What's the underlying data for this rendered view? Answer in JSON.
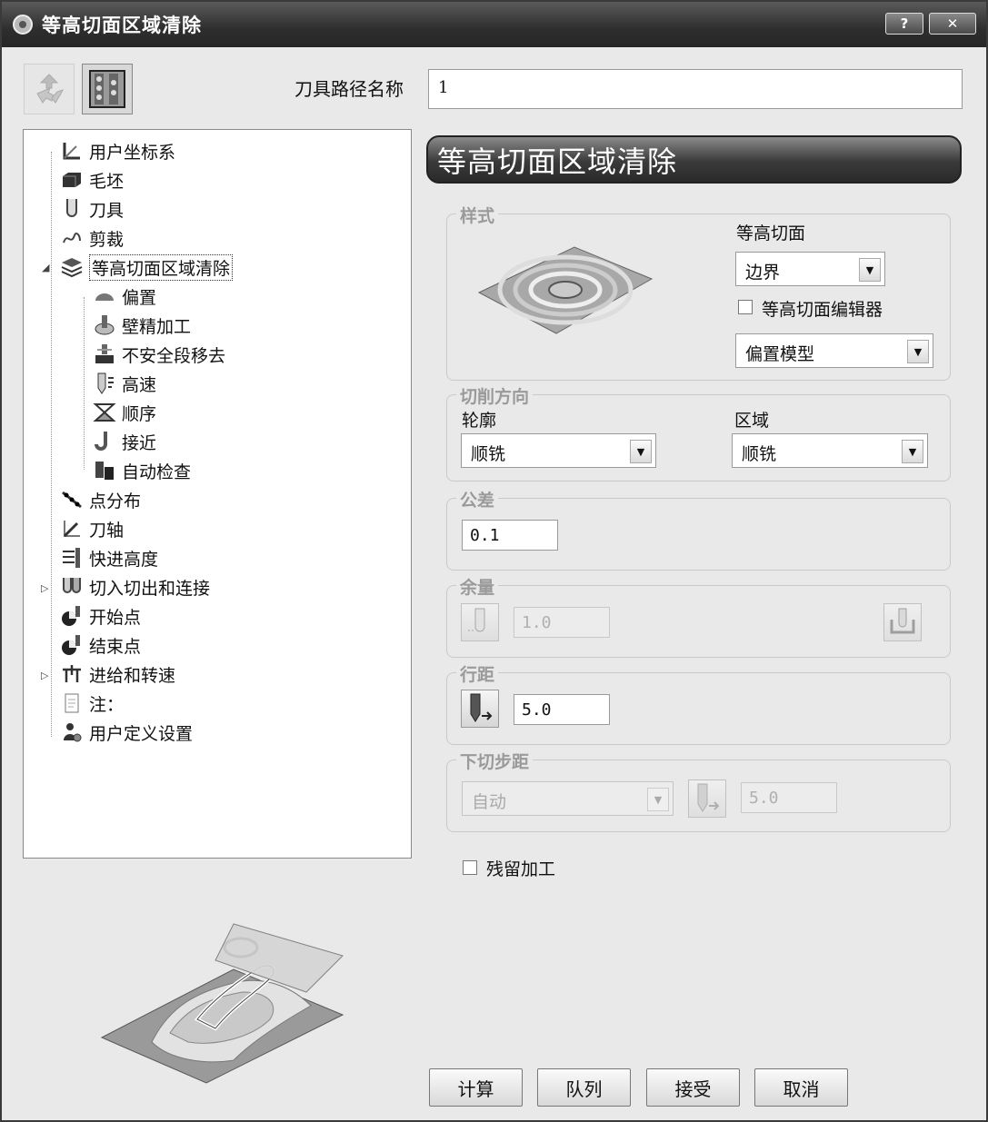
{
  "window": {
    "title": "等高切面区域清除",
    "help_label": "?",
    "close_label": "✕"
  },
  "toolbar": {
    "name_label": "刀具路径名称",
    "name_value": "1"
  },
  "tree": {
    "items": [
      {
        "label": "用户坐标系",
        "icon": "axis-icon"
      },
      {
        "label": "毛坯",
        "icon": "block-icon"
      },
      {
        "label": "刀具",
        "icon": "tool-icon"
      },
      {
        "label": "剪裁",
        "icon": "trim-icon"
      },
      {
        "label": "等高切面区域清除",
        "icon": "layers-icon",
        "selected": true
      },
      {
        "label": "偏置",
        "icon": "offset-icon"
      },
      {
        "label": "壁精加工",
        "icon": "wall-finish-icon"
      },
      {
        "label": "不安全段移去",
        "icon": "unsafe-remove-icon"
      },
      {
        "label": "高速",
        "icon": "high-speed-icon"
      },
      {
        "label": "顺序",
        "icon": "order-icon"
      },
      {
        "label": "接近",
        "icon": "approach-icon"
      },
      {
        "label": "自动检查",
        "icon": "auto-check-icon"
      },
      {
        "label": "点分布",
        "icon": "point-distribution-icon"
      },
      {
        "label": "刀轴",
        "icon": "tool-axis-icon"
      },
      {
        "label": "快进高度",
        "icon": "rapid-height-icon"
      },
      {
        "label": "切入切出和连接",
        "icon": "leads-links-icon"
      },
      {
        "label": "开始点",
        "icon": "start-point-icon"
      },
      {
        "label": "结束点",
        "icon": "end-point-icon"
      },
      {
        "label": "进给和转速",
        "icon": "feeds-speeds-icon"
      },
      {
        "label": "注：",
        "icon": "note-icon"
      },
      {
        "label": "用户定义设置",
        "icon": "user-settings-icon"
      }
    ]
  },
  "panel": {
    "banner": "等高切面区域清除",
    "style": {
      "title": "样式",
      "slice_label": "等高切面",
      "slice_value": "边界",
      "editor_label": "等高切面编辑器",
      "model_value": "偏置模型"
    },
    "cut_direction": {
      "title": "切削方向",
      "profile_label": "轮廓",
      "profile_value": "顺铣",
      "area_label": "区域",
      "area_value": "顺铣"
    },
    "tolerance": {
      "title": "公差",
      "value": "0.1"
    },
    "allowance": {
      "title": "余量",
      "value": "1.0"
    },
    "stepover": {
      "title": "行距",
      "value": "5.0"
    },
    "stepdown": {
      "title": "下切步距",
      "mode": "自动",
      "value": "5.0"
    },
    "rest_label": "残留加工"
  },
  "buttons": {
    "calculate": "计算",
    "queue": "队列",
    "accept": "接受",
    "cancel": "取消"
  }
}
